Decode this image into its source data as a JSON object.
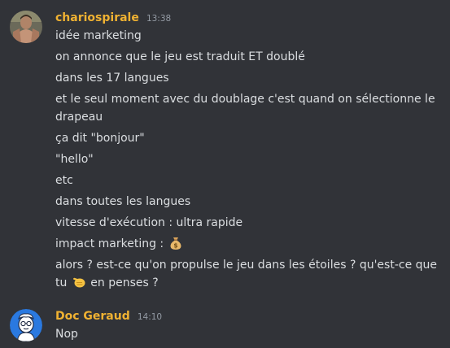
{
  "messages": [
    {
      "author": "chariospirale",
      "author_color": "#f0b232",
      "timestamp": "13:38",
      "avatar": "user-photo-avatar",
      "lines": [
        "idée marketing",
        "on annonce que le jeu est traduit ET doublé",
        "dans les 17 langues",
        "et le seul moment avec du doublage c'est quand on sélectionne le drapeau",
        "ça dit \"bonjour\"",
        "\"hello\"",
        "etc",
        "dans toutes les langues",
        "vitesse d'exécution : ultra rapide"
      ],
      "impact_line": {
        "text": "impact marketing : ",
        "emoji": "money-bag-emoji"
      },
      "last_line": {
        "before": "alors ? est-ce qu'on propulse le jeu dans les étoiles ? qu'est-ce que tu ",
        "emoji": "pointing-hand-emoji",
        "after": " en penses ?"
      }
    },
    {
      "author": "Doc Geraud",
      "author_color": "#f0b232",
      "timestamp": "14:10",
      "avatar": "cartoon-doctor-avatar",
      "lines": [
        "Nop"
      ]
    }
  ]
}
